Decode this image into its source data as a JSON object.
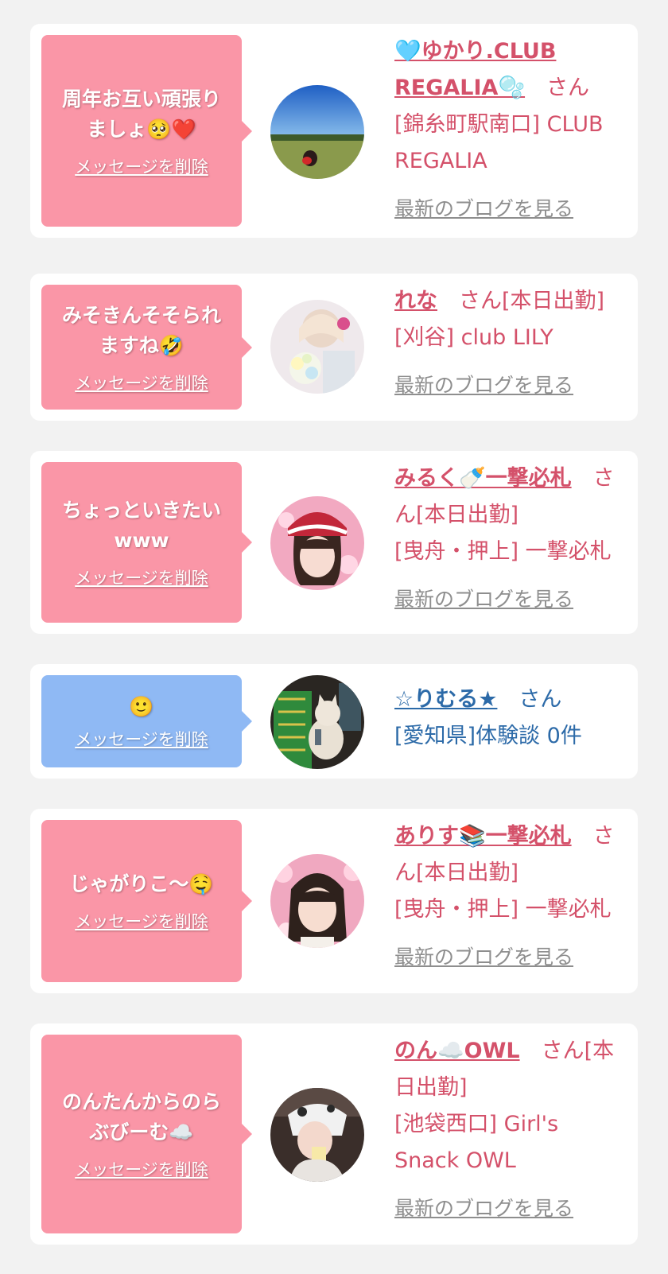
{
  "delete_label": "メッセージを削除",
  "blog_label": "最新のブログを見る",
  "san_label": "さん",
  "colors": {
    "pink_bubble": "#fa96a7",
    "blue_bubble": "#8fb9f4",
    "pink_text": "#d4516a",
    "blue_text": "#2c6aa8",
    "link_gray": "#8e8e8e",
    "background": "#f2f2f2"
  },
  "cards": [
    {
      "message": "周年お互い頑張りましょ🥺❤️",
      "name": "🩵ゆかり.CLUB REGALIA🫧",
      "status": "",
      "shop": "[錦糸町駅南口] CLUB REGALIA",
      "avatar_icon": "golf-course-photo"
    },
    {
      "message": "みそきんそそられますね🤣",
      "name": "れな",
      "status": "[本日出勤]",
      "shop": "[刈谷] club LILY",
      "avatar_icon": "woman-with-flowers-photo"
    },
    {
      "message": "ちょっといきたいwww",
      "name": "みるく🍼一撃必札",
      "status": "[本日出勤]",
      "shop": "[曳舟・押上] 一撃必札",
      "avatar_icon": "woman-headdress-photo"
    },
    {
      "message": "🙂",
      "name": "☆りむる★",
      "status": "",
      "shop": "[愛知県]体験談 0件",
      "avatar_icon": "cat-figure-photo"
    },
    {
      "message": "じゃがりこ〜🤤",
      "name": "ありす📚一撃必札",
      "status": "[本日出勤]",
      "shop": "[曳舟・押上] 一撃必札",
      "avatar_icon": "woman-portrait-photo"
    },
    {
      "message": "のんたんからのらぶびーむ☁️",
      "name": "のん☁️OWL",
      "status": "[本日出勤]",
      "shop": "[池袋西口] Girl's Snack OWL",
      "avatar_icon": "woman-drinking-photo"
    }
  ]
}
